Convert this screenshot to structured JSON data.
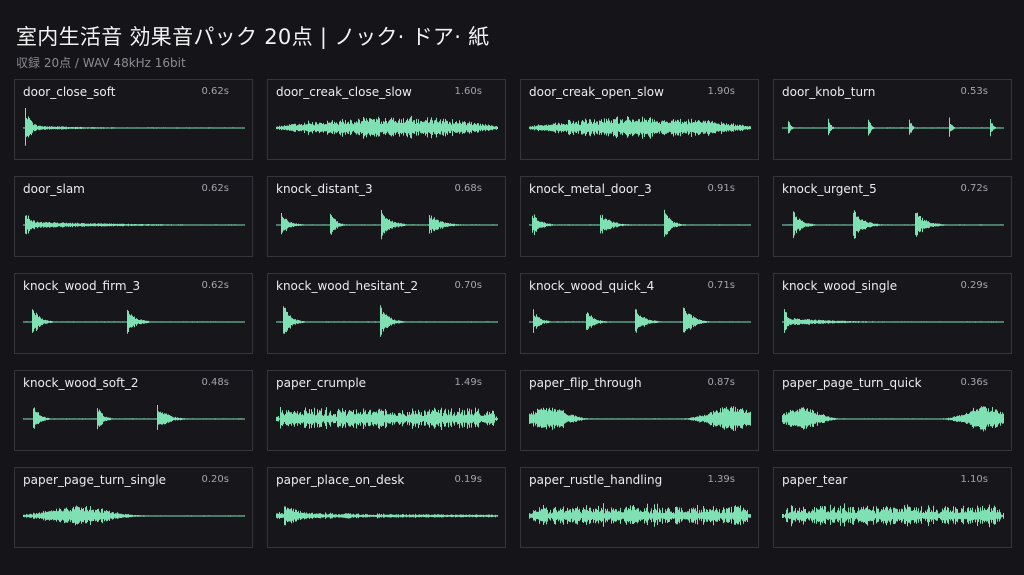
{
  "header": {
    "title": "室内生活音 効果音パック 20点 | ノック· ドア· 紙",
    "subtitle": "収録 20点  /  WAV 48kHz 16bit"
  },
  "colors": {
    "background": "#151419",
    "card_border": "#36353b",
    "waveform": "#7fe0b4"
  },
  "items": [
    {
      "name": "door_close_soft",
      "duration": "0.62s",
      "wave": "door_close"
    },
    {
      "name": "door_creak_close_slow",
      "duration": "1.60s",
      "wave": "creak"
    },
    {
      "name": "door_creak_open_slow",
      "duration": "1.90s",
      "wave": "creak"
    },
    {
      "name": "door_knob_turn",
      "duration": "0.53s",
      "wave": "knob"
    },
    {
      "name": "door_slam",
      "duration": "0.62s",
      "wave": "slam"
    },
    {
      "name": "knock_distant_3",
      "duration": "0.68s",
      "wave": "knocks"
    },
    {
      "name": "knock_metal_door_3",
      "duration": "0.91s",
      "wave": "knocks"
    },
    {
      "name": "knock_urgent_5",
      "duration": "0.72s",
      "wave": "knocks"
    },
    {
      "name": "knock_wood_firm_3",
      "duration": "0.62s",
      "wave": "knocks"
    },
    {
      "name": "knock_wood_hesitant_2",
      "duration": "0.70s",
      "wave": "knocks"
    },
    {
      "name": "knock_wood_quick_4",
      "duration": "0.71s",
      "wave": "knocks"
    },
    {
      "name": "knock_wood_single",
      "duration": "0.29s",
      "wave": "single"
    },
    {
      "name": "knock_wood_soft_2",
      "duration": "0.48s",
      "wave": "knocks"
    },
    {
      "name": "paper_crumple",
      "duration": "1.49s",
      "wave": "noise"
    },
    {
      "name": "paper_flip_through",
      "duration": "0.87s",
      "wave": "blobs"
    },
    {
      "name": "paper_page_turn_quick",
      "duration": "0.36s",
      "wave": "blobs"
    },
    {
      "name": "paper_page_turn_single",
      "duration": "0.20s",
      "wave": "swell"
    },
    {
      "name": "paper_place_on_desk",
      "duration": "0.19s",
      "wave": "place"
    },
    {
      "name": "paper_rustle_handling",
      "duration": "1.39s",
      "wave": "noise"
    },
    {
      "name": "paper_tear",
      "duration": "1.10s",
      "wave": "noise"
    }
  ]
}
